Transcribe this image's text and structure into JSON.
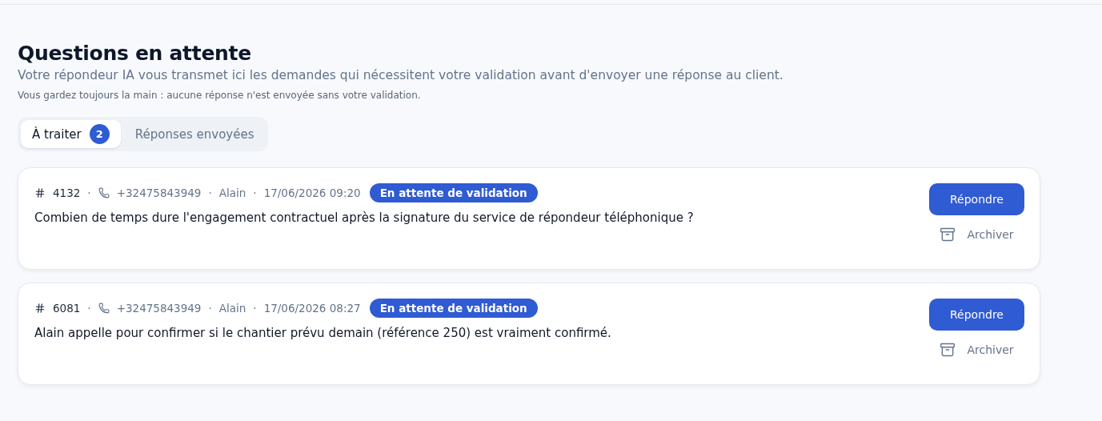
{
  "header": {
    "title": "Questions en attente",
    "subtitle": "Votre répondeur IA vous transmet ici les demandes qui nécessitent votre validation avant d'envoyer une réponse au client.",
    "note": "Vous gardez toujours la main : aucune réponse n'est envoyée sans votre validation."
  },
  "tabs": [
    {
      "label": "À traiter",
      "count": "2",
      "selected": true
    },
    {
      "label": "Réponses envoyées",
      "selected": false
    }
  ],
  "separator": "·",
  "questions": [
    {
      "id": "4132",
      "phone": "+32475843949",
      "name": "Alain",
      "date": "17/06/2026 09:20",
      "status": "En attente de validation",
      "text": "Combien de temps dure l'engagement contractuel après la signature du service de répondeur téléphonique ?",
      "reply": "Répondre",
      "archive": "Archiver"
    },
    {
      "id": "6081",
      "phone": "+32475843949",
      "name": "Alain",
      "date": "17/06/2026 08:27",
      "status": "En attente de validation",
      "text": "Alain appelle pour confirmer si le chantier prévu demain (référence 250) est vraiment confirmé.",
      "reply": "Répondre",
      "archive": "Archiver"
    }
  ]
}
